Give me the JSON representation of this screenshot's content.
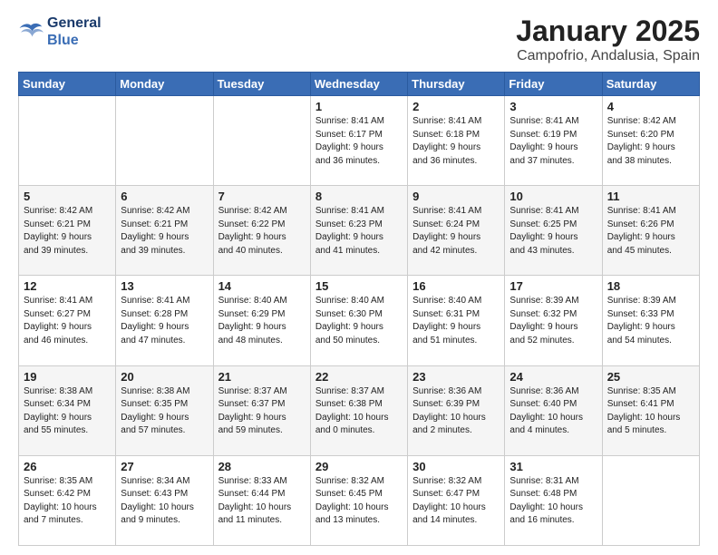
{
  "logo": {
    "line1": "General",
    "line2": "Blue"
  },
  "title": "January 2025",
  "subtitle": "Campofrio, Andalusia, Spain",
  "days_of_week": [
    "Sunday",
    "Monday",
    "Tuesday",
    "Wednesday",
    "Thursday",
    "Friday",
    "Saturday"
  ],
  "weeks": [
    [
      {
        "day": "",
        "info": ""
      },
      {
        "day": "",
        "info": ""
      },
      {
        "day": "",
        "info": ""
      },
      {
        "day": "1",
        "info": "Sunrise: 8:41 AM\nSunset: 6:17 PM\nDaylight: 9 hours\nand 36 minutes."
      },
      {
        "day": "2",
        "info": "Sunrise: 8:41 AM\nSunset: 6:18 PM\nDaylight: 9 hours\nand 36 minutes."
      },
      {
        "day": "3",
        "info": "Sunrise: 8:41 AM\nSunset: 6:19 PM\nDaylight: 9 hours\nand 37 minutes."
      },
      {
        "day": "4",
        "info": "Sunrise: 8:42 AM\nSunset: 6:20 PM\nDaylight: 9 hours\nand 38 minutes."
      }
    ],
    [
      {
        "day": "5",
        "info": "Sunrise: 8:42 AM\nSunset: 6:21 PM\nDaylight: 9 hours\nand 39 minutes."
      },
      {
        "day": "6",
        "info": "Sunrise: 8:42 AM\nSunset: 6:21 PM\nDaylight: 9 hours\nand 39 minutes."
      },
      {
        "day": "7",
        "info": "Sunrise: 8:42 AM\nSunset: 6:22 PM\nDaylight: 9 hours\nand 40 minutes."
      },
      {
        "day": "8",
        "info": "Sunrise: 8:41 AM\nSunset: 6:23 PM\nDaylight: 9 hours\nand 41 minutes."
      },
      {
        "day": "9",
        "info": "Sunrise: 8:41 AM\nSunset: 6:24 PM\nDaylight: 9 hours\nand 42 minutes."
      },
      {
        "day": "10",
        "info": "Sunrise: 8:41 AM\nSunset: 6:25 PM\nDaylight: 9 hours\nand 43 minutes."
      },
      {
        "day": "11",
        "info": "Sunrise: 8:41 AM\nSunset: 6:26 PM\nDaylight: 9 hours\nand 45 minutes."
      }
    ],
    [
      {
        "day": "12",
        "info": "Sunrise: 8:41 AM\nSunset: 6:27 PM\nDaylight: 9 hours\nand 46 minutes."
      },
      {
        "day": "13",
        "info": "Sunrise: 8:41 AM\nSunset: 6:28 PM\nDaylight: 9 hours\nand 47 minutes."
      },
      {
        "day": "14",
        "info": "Sunrise: 8:40 AM\nSunset: 6:29 PM\nDaylight: 9 hours\nand 48 minutes."
      },
      {
        "day": "15",
        "info": "Sunrise: 8:40 AM\nSunset: 6:30 PM\nDaylight: 9 hours\nand 50 minutes."
      },
      {
        "day": "16",
        "info": "Sunrise: 8:40 AM\nSunset: 6:31 PM\nDaylight: 9 hours\nand 51 minutes."
      },
      {
        "day": "17",
        "info": "Sunrise: 8:39 AM\nSunset: 6:32 PM\nDaylight: 9 hours\nand 52 minutes."
      },
      {
        "day": "18",
        "info": "Sunrise: 8:39 AM\nSunset: 6:33 PM\nDaylight: 9 hours\nand 54 minutes."
      }
    ],
    [
      {
        "day": "19",
        "info": "Sunrise: 8:38 AM\nSunset: 6:34 PM\nDaylight: 9 hours\nand 55 minutes."
      },
      {
        "day": "20",
        "info": "Sunrise: 8:38 AM\nSunset: 6:35 PM\nDaylight: 9 hours\nand 57 minutes."
      },
      {
        "day": "21",
        "info": "Sunrise: 8:37 AM\nSunset: 6:37 PM\nDaylight: 9 hours\nand 59 minutes."
      },
      {
        "day": "22",
        "info": "Sunrise: 8:37 AM\nSunset: 6:38 PM\nDaylight: 10 hours\nand 0 minutes."
      },
      {
        "day": "23",
        "info": "Sunrise: 8:36 AM\nSunset: 6:39 PM\nDaylight: 10 hours\nand 2 minutes."
      },
      {
        "day": "24",
        "info": "Sunrise: 8:36 AM\nSunset: 6:40 PM\nDaylight: 10 hours\nand 4 minutes."
      },
      {
        "day": "25",
        "info": "Sunrise: 8:35 AM\nSunset: 6:41 PM\nDaylight: 10 hours\nand 5 minutes."
      }
    ],
    [
      {
        "day": "26",
        "info": "Sunrise: 8:35 AM\nSunset: 6:42 PM\nDaylight: 10 hours\nand 7 minutes."
      },
      {
        "day": "27",
        "info": "Sunrise: 8:34 AM\nSunset: 6:43 PM\nDaylight: 10 hours\nand 9 minutes."
      },
      {
        "day": "28",
        "info": "Sunrise: 8:33 AM\nSunset: 6:44 PM\nDaylight: 10 hours\nand 11 minutes."
      },
      {
        "day": "29",
        "info": "Sunrise: 8:32 AM\nSunset: 6:45 PM\nDaylight: 10 hours\nand 13 minutes."
      },
      {
        "day": "30",
        "info": "Sunrise: 8:32 AM\nSunset: 6:47 PM\nDaylight: 10 hours\nand 14 minutes."
      },
      {
        "day": "31",
        "info": "Sunrise: 8:31 AM\nSunset: 6:48 PM\nDaylight: 10 hours\nand 16 minutes."
      },
      {
        "day": "",
        "info": ""
      }
    ]
  ]
}
